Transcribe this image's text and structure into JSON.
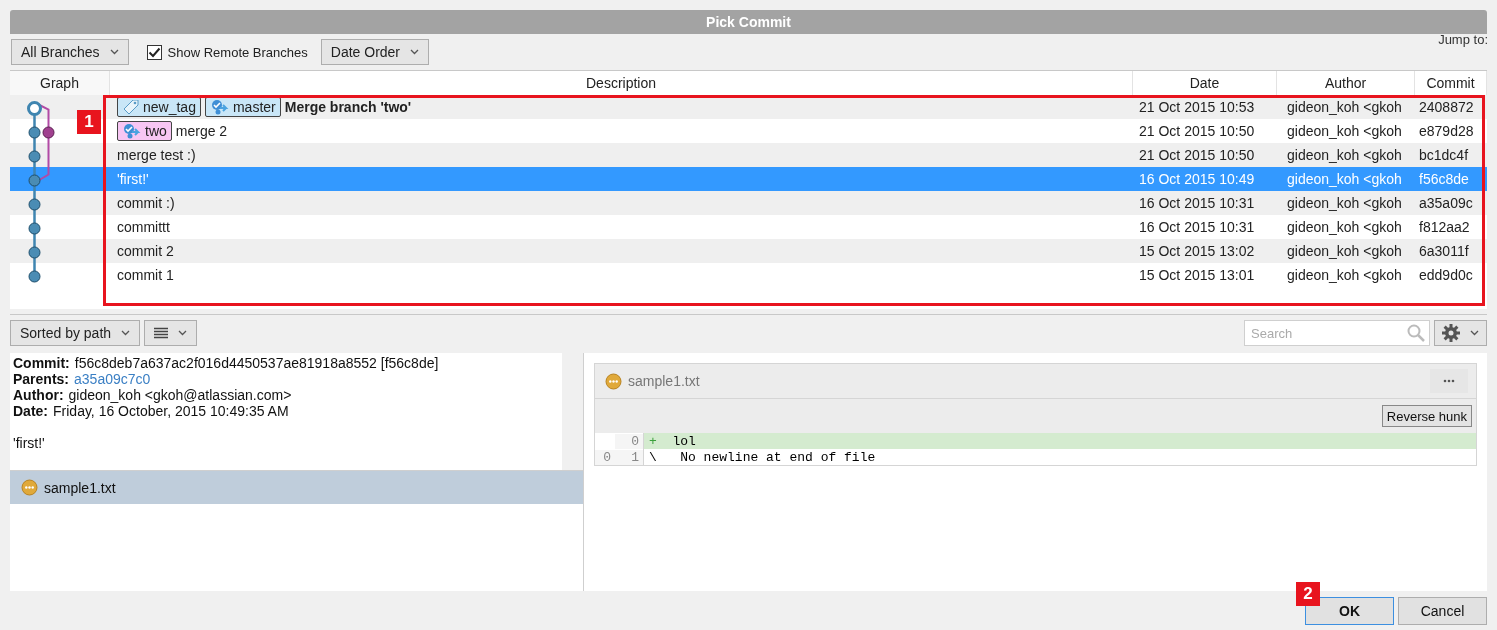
{
  "window": {
    "title": "Pick Commit"
  },
  "toolbar": {
    "branch_filter": "All Branches",
    "show_remote": {
      "label": "Show Remote Branches",
      "checked": true
    },
    "order": "Date Order",
    "jump_to": "Jump to:"
  },
  "table": {
    "columns": [
      "Graph",
      "Description",
      "Date",
      "Author",
      "Commit"
    ],
    "rows": [
      {
        "refs": [
          {
            "kind": "tag",
            "label": "new_tag",
            "color": "#c9e6f7"
          },
          {
            "kind": "branch",
            "label": "master",
            "color": "#c9e6f7"
          }
        ],
        "description": "Merge branch 'two'",
        "head": true,
        "date": "21 Oct 2015 10:53",
        "author": "gideon_koh <gkoh",
        "commit": "2408872",
        "selected": false
      },
      {
        "refs": [
          {
            "kind": "branch",
            "label": "two",
            "color": "#f7c6f3"
          }
        ],
        "description": "merge 2",
        "head": false,
        "date": "21 Oct 2015 10:50",
        "author": "gideon_koh <gkoh",
        "commit": "e879d28",
        "selected": false
      },
      {
        "description": "merge test :)",
        "head": false,
        "date": "21 Oct 2015 10:50",
        "author": "gideon_koh <gkoh",
        "commit": "bc1dc4f",
        "selected": false
      },
      {
        "description": "'first!'",
        "head": false,
        "date": "16 Oct 2015 10:49",
        "author": "gideon_koh <gkoh",
        "commit": "f56c8de",
        "selected": true
      },
      {
        "description": "commit :)",
        "head": false,
        "date": "16 Oct 2015 10:31",
        "author": "gideon_koh <gkoh",
        "commit": "a35a09c",
        "selected": false
      },
      {
        "description": "committt",
        "head": false,
        "date": "16 Oct 2015 10:31",
        "author": "gideon_koh <gkoh",
        "commit": "f812aa2",
        "selected": false
      },
      {
        "description": "commit 2",
        "head": false,
        "date": "15 Oct 2015 13:02",
        "author": "gideon_koh <gkoh",
        "commit": "6a3011f",
        "selected": false
      },
      {
        "description": "commit 1",
        "head": false,
        "date": "15 Oct 2015 13:01",
        "author": "gideon_koh <gkoh",
        "commit": "edd9d0c",
        "selected": false
      }
    ]
  },
  "file_toolbar": {
    "sort": "Sorted by path",
    "search": {
      "placeholder": "Search"
    }
  },
  "details": {
    "lines": [
      {
        "label": "Commit:",
        "value": "f56c8deb7a637ac2f016d4450537ae81918a8552 [f56c8de]",
        "kind": "text"
      },
      {
        "label": "Parents:",
        "value": "a35a09c7c0",
        "kind": "link"
      },
      {
        "label": "Author:",
        "value": "gideon_koh <gkoh@atlassian.com>",
        "kind": "text"
      },
      {
        "label": "Date:",
        "value": "Friday, 16 October, 2015 10:49:35 AM",
        "kind": "text"
      }
    ],
    "message": "'first!'"
  },
  "files": [
    {
      "name": "sample1.txt",
      "selected": true
    }
  ],
  "diff": {
    "file": "sample1.txt",
    "action": "Reverse hunk",
    "lines": [
      {
        "kind": "added",
        "new": "0",
        "marker": "+",
        "text": "lol"
      },
      {
        "kind": "context",
        "old": "0",
        "new": "1",
        "marker": "\\",
        "text": " No newline at end of file"
      }
    ]
  },
  "buttons": [
    {
      "label": "OK",
      "default": true
    },
    {
      "label": "Cancel",
      "default": false
    }
  ],
  "callouts": [
    {
      "label": "1"
    },
    {
      "label": "2"
    }
  ]
}
